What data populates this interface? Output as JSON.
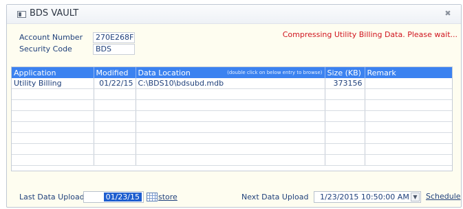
{
  "window": {
    "title": "BDS VAULT"
  },
  "account": {
    "number_label": "Account Number",
    "number_value": "270E268F",
    "code_label": "Security Code",
    "code_value": "BDS"
  },
  "status_message": "Compressing Utility Billing Data.  Please wait...",
  "grid": {
    "columns": [
      "Application",
      "Modified",
      "Data Location",
      "Size (KB)",
      "Remark"
    ],
    "location_hint": "(double click on below entry to browse)",
    "rows": [
      [
        "Utility Billing",
        "01/22/15",
        "C:\\BDS10\\bdsubd.mdb",
        "373156",
        ""
      ]
    ]
  },
  "footer": {
    "last_upload_label": "Last Data Upload",
    "last_upload_value": "01/23/15",
    "restore_label": "store",
    "next_upload_label": "Next Data Upload",
    "next_upload_value": "1/23/2015 10:50:00 AM",
    "schedule_label": "Schedule"
  },
  "icons": {
    "app": "window-icon",
    "close": "close-icon",
    "calendar": "calendar-icon",
    "dropdown": "chevron-down-icon"
  }
}
